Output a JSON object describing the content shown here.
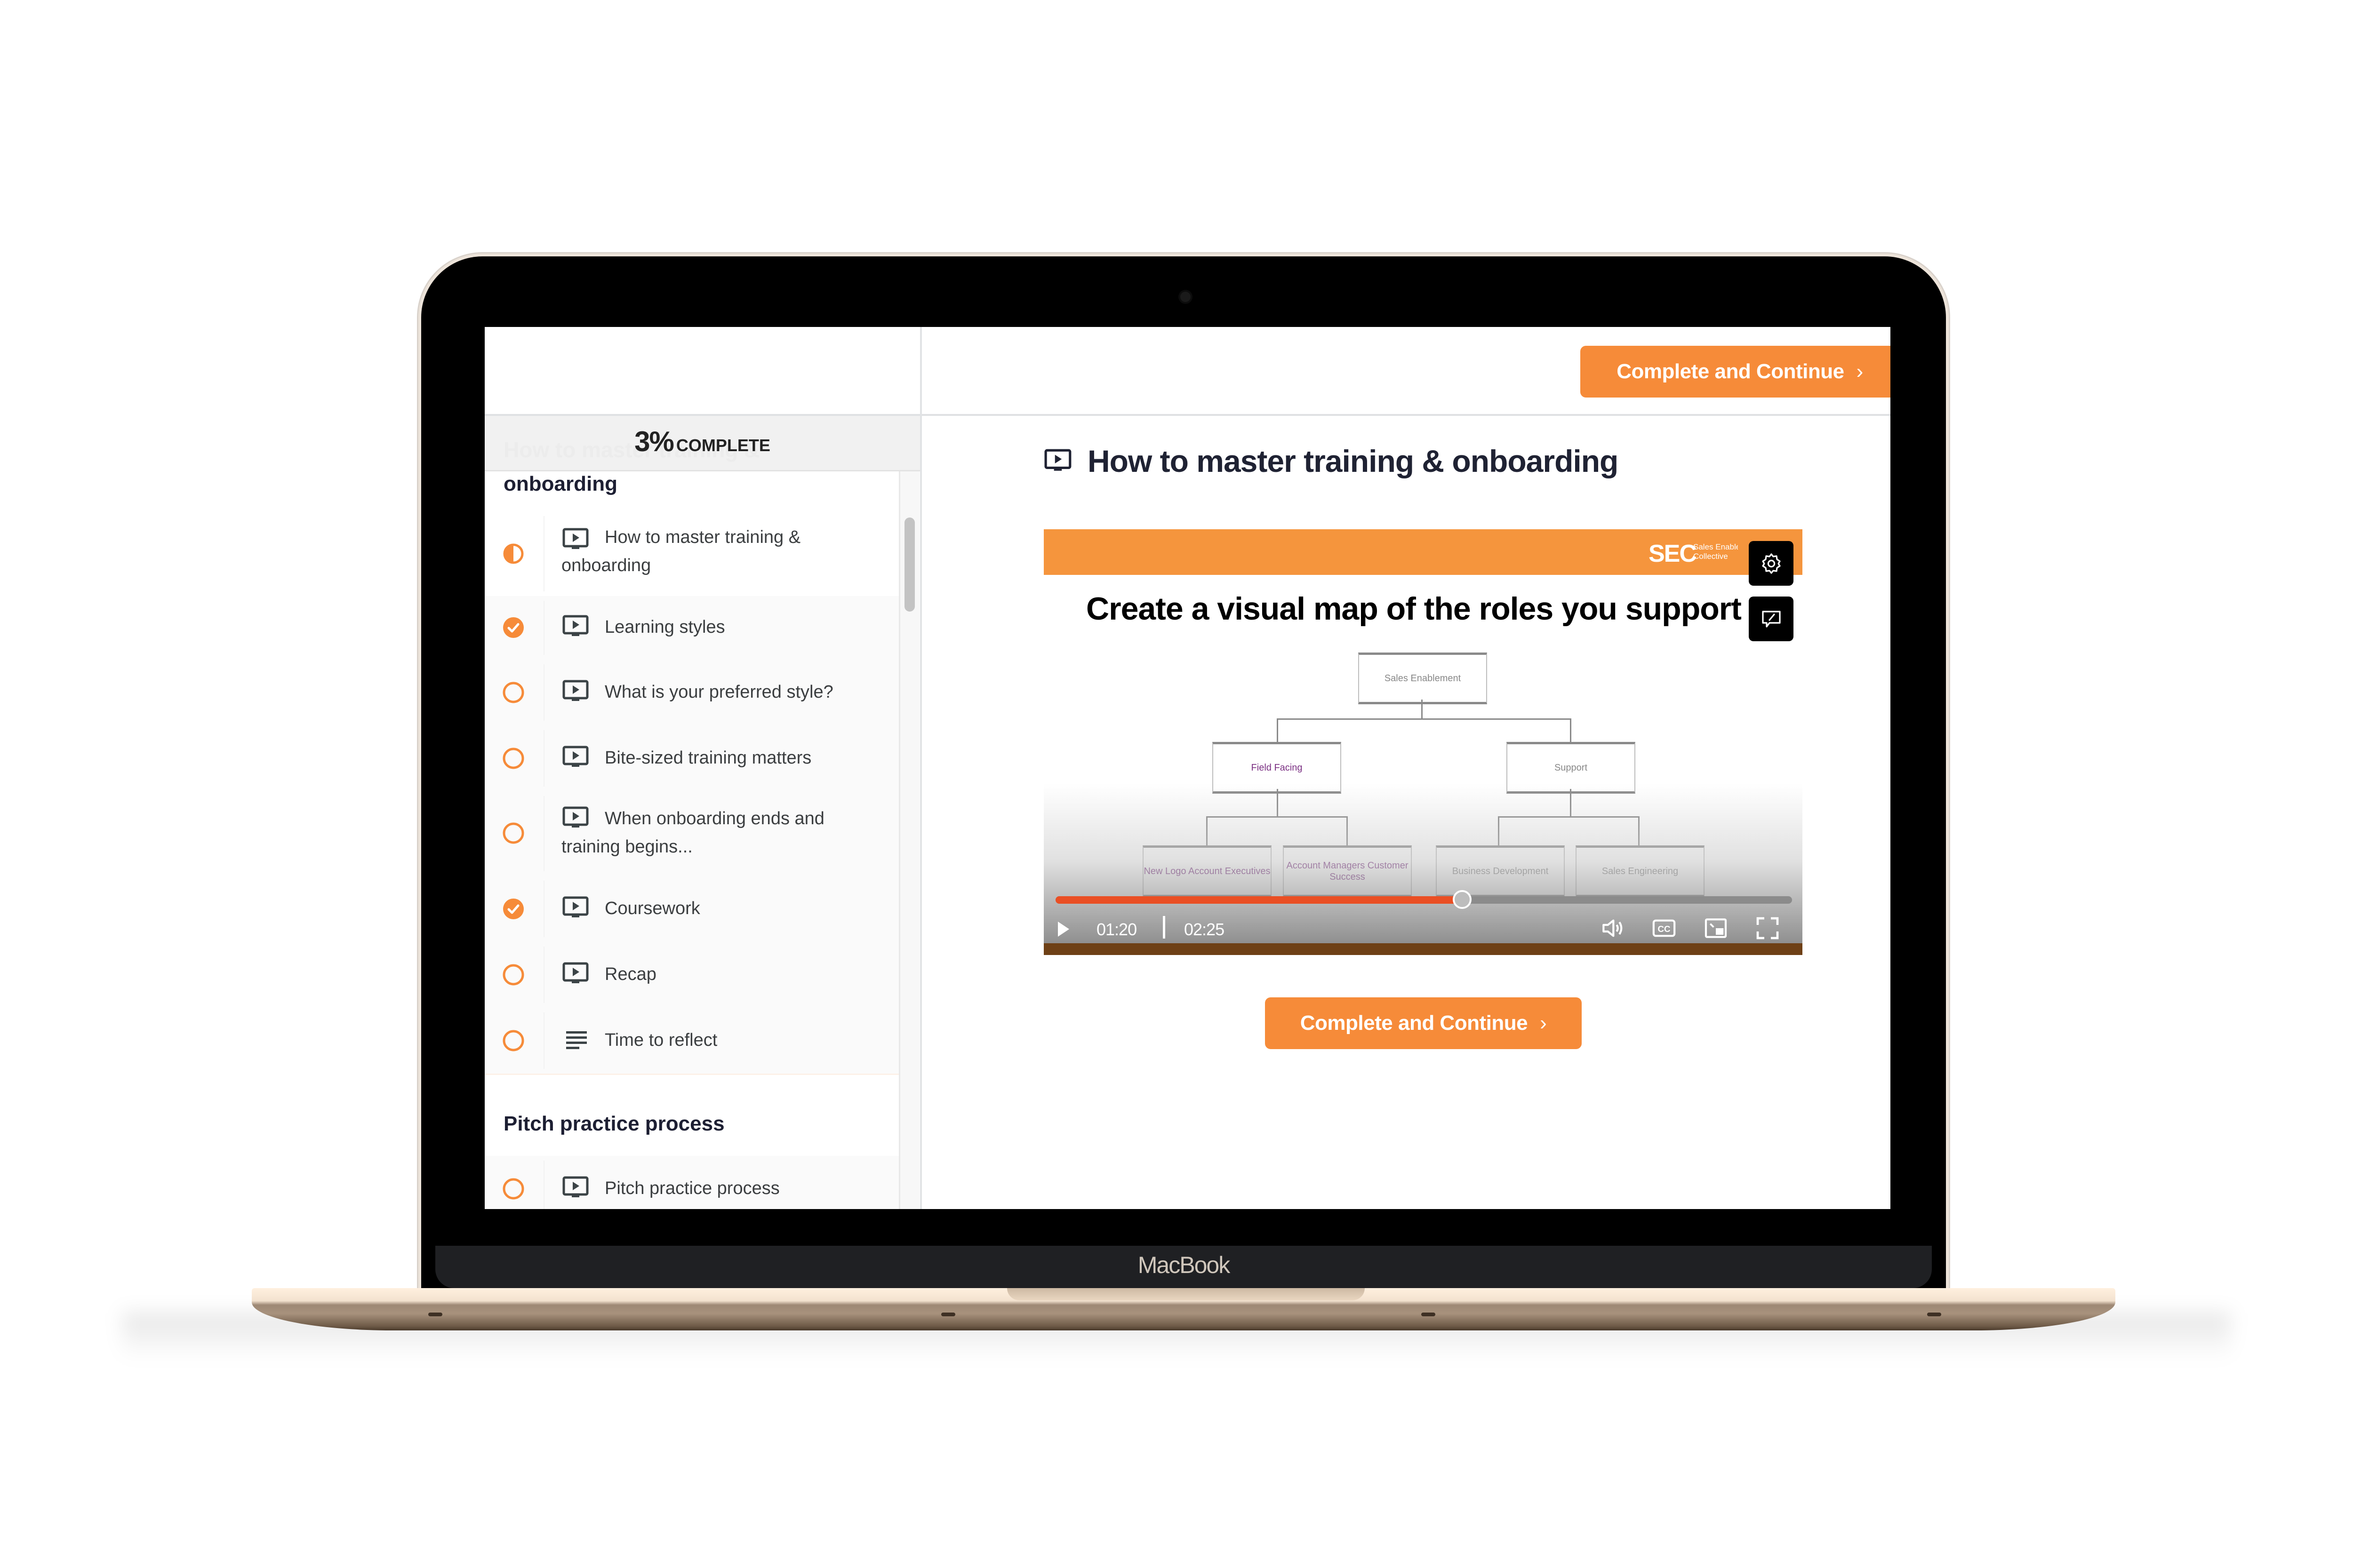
{
  "device": {
    "brand_label": "MacBook"
  },
  "colors": {
    "accent": "#f68b39",
    "banner": "#f5953d",
    "seek_played": "#ea4f24",
    "heading": "#1f2233",
    "lesson_text": "#3b3e40"
  },
  "sidebar": {
    "progress": {
      "percent_label": "3%",
      "suffix": "COMPLETE",
      "value_percent": 3
    },
    "ghost_title": "How to master training &",
    "sections": [
      {
        "title": "onboarding",
        "lessons": [
          {
            "title": "How to master training & onboarding",
            "type_icon": "video-icon",
            "status": "in-progress",
            "active": true
          },
          {
            "title": "Learning styles",
            "type_icon": "video-icon",
            "status": "completed"
          },
          {
            "title": "What is your preferred style?",
            "type_icon": "video-icon",
            "status": "not-started"
          },
          {
            "title": "Bite-sized training matters",
            "type_icon": "video-icon",
            "status": "not-started"
          },
          {
            "title": "When onboarding ends and training begins...",
            "type_icon": "video-icon",
            "status": "not-started"
          },
          {
            "title": "Coursework",
            "type_icon": "video-icon",
            "status": "completed"
          },
          {
            "title": "Recap",
            "type_icon": "video-icon",
            "status": "not-started"
          },
          {
            "title": "Time to reflect",
            "type_icon": "text-lines-icon",
            "status": "not-started"
          }
        ]
      },
      {
        "title": "Pitch practice process",
        "lessons": [
          {
            "title": "Pitch practice process",
            "type_icon": "video-icon",
            "status": "not-started"
          }
        ]
      }
    ]
  },
  "header": {
    "complete_button": {
      "label": "Complete and Continue",
      "icon": "chevron-right-icon"
    }
  },
  "lesson": {
    "title": "How to master training & onboarding",
    "type_icon": "video-icon",
    "complete_button": {
      "label": "Complete and Continue",
      "icon": "chevron-right-icon"
    }
  },
  "video": {
    "logo_mark": "SEC",
    "logo_text_line1": "Sales Enablement",
    "logo_text_line2": "Collective",
    "slide_title": "Create a visual map of the roles you support",
    "org_chart": {
      "root": "Sales Enablement",
      "level2": [
        "Field Facing",
        "Support"
      ],
      "level3": [
        "New Logo Account Executives",
        "Account Managers Customer Success",
        "Business Development",
        "Sales Engineering"
      ]
    },
    "current_time": "01:20",
    "duration": "02:25",
    "progress_fraction": 0.552,
    "controls": [
      "play-icon",
      "volume-icon",
      "closed-captions-icon",
      "picture-in-picture-icon",
      "fullscreen-icon"
    ],
    "side_buttons": [
      "settings-gear-icon",
      "annotation-comment-icon"
    ]
  }
}
